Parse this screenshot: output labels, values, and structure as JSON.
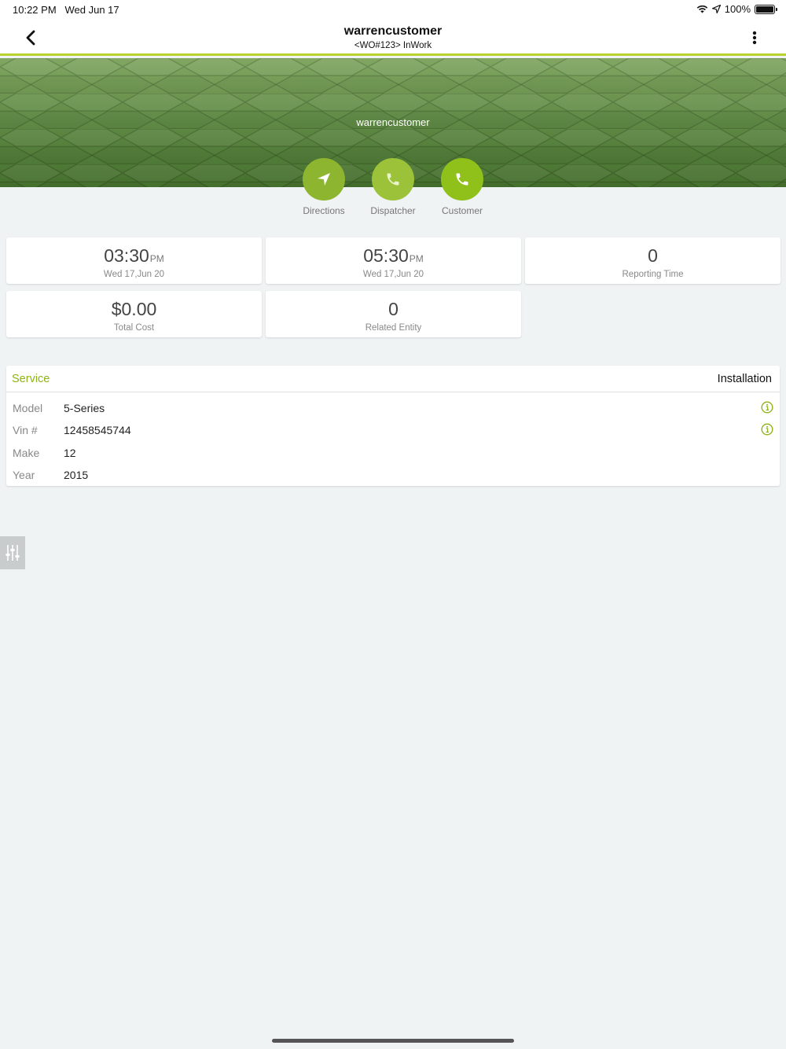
{
  "status_bar": {
    "time": "10:22 PM",
    "date": "Wed Jun 17",
    "battery": "100%"
  },
  "nav": {
    "title": "warrencustomer",
    "subtitle": "<WO#123>  InWork",
    "back_icon": "chevron-left-icon",
    "more_icon": "more-vertical-icon"
  },
  "hero": {
    "customer_name": "warrencustomer"
  },
  "actions": [
    {
      "label": "Directions",
      "icon": "navigation-arrow-icon",
      "color": "#8db52f"
    },
    {
      "label": "Dispatcher",
      "icon": "phone-icon",
      "color": "#9cc23a"
    },
    {
      "label": "Customer",
      "icon": "phone-icon",
      "color": "#8fc11a"
    }
  ],
  "stats": {
    "start": {
      "time": "03:30",
      "ampm": "PM",
      "date": "Wed 17,Jun 20"
    },
    "end": {
      "time": "05:30",
      "ampm": "PM",
      "date": "Wed 17,Jun 20"
    },
    "reporting": {
      "value": "0",
      "label": "Reporting Time"
    },
    "cost": {
      "value": "$0.00",
      "label": "Total Cost"
    },
    "related": {
      "value": "0",
      "label": "Related Entity"
    }
  },
  "service": {
    "title": "Service",
    "type": "Installation",
    "rows": [
      {
        "label": "Model",
        "value": "5-Series",
        "info": true
      },
      {
        "label": "Vin #",
        "value": "12458545744",
        "info": true
      },
      {
        "label": "Make",
        "value": "12",
        "info": false
      },
      {
        "label": "Year",
        "value": "2015",
        "info": false
      }
    ]
  },
  "colors": {
    "accent": "#8fb319",
    "nav_border": "#b9d22c",
    "background": "#eff3f3"
  }
}
